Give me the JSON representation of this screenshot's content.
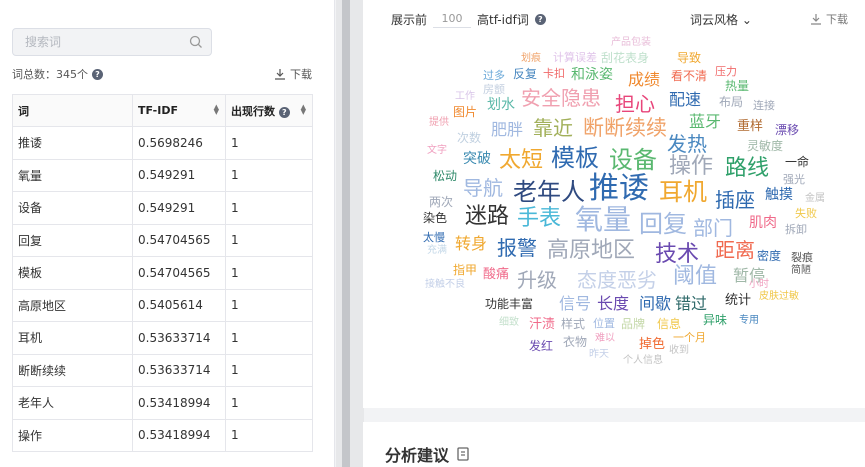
{
  "left": {
    "search_placeholder": "搜索词",
    "word_count_label": "词总数：345个",
    "download_label": "下载",
    "table": {
      "headers": [
        "词",
        "TF-IDF",
        "出现行数"
      ],
      "rows": [
        [
          "推诿",
          "0.5698246",
          "1"
        ],
        [
          "氧量",
          "0.549291",
          "1"
        ],
        [
          "设备",
          "0.549291",
          "1"
        ],
        [
          "回复",
          "0.54704565",
          "1"
        ],
        [
          "模板",
          "0.54704565",
          "1"
        ],
        [
          "高原地区",
          "0.5405614",
          "1"
        ],
        [
          "耳机",
          "0.53633714",
          "1"
        ],
        [
          "断断续续",
          "0.53633714",
          "1"
        ],
        [
          "老年人",
          "0.53418994",
          "1"
        ],
        [
          "操作",
          "0.53418994",
          "1"
        ]
      ]
    }
  },
  "right": {
    "show_prefix": "展示前",
    "show_count": "100",
    "show_suffix": "高tf-idf词",
    "style_label": "词云风格",
    "download_label": "下载",
    "words": [
      [
        "划痕",
        158,
        54,
        10,
        "#f0a36a"
      ],
      [
        "计算误差",
        190,
        52,
        11,
        "#e0c4ea"
      ],
      [
        "产品包装",
        248,
        38,
        10,
        "#e8bcd8"
      ],
      [
        "刮花表身",
        238,
        52,
        12,
        "#bfe0cc"
      ],
      [
        "导致",
        314,
        52,
        12,
        "#f0a830"
      ],
      [
        "过多",
        120,
        70,
        11,
        "#6aa8d8"
      ],
      [
        "反复",
        150,
        68,
        12,
        "#4a88c0"
      ],
      [
        "卡扣",
        180,
        68,
        11,
        "#f06a6a"
      ],
      [
        "和泳姿",
        208,
        68,
        14,
        "#5ab870"
      ],
      [
        "成绩",
        265,
        72,
        16,
        "#f08a30"
      ],
      [
        "看不清",
        308,
        70,
        12,
        "#f06a50"
      ],
      [
        "压力",
        352,
        66,
        11,
        "#f06a6a"
      ],
      [
        "房颤",
        120,
        84,
        11,
        "#c4d0e0"
      ],
      [
        "热量",
        362,
        80,
        12,
        "#5ab870"
      ],
      [
        "安全隐患",
        158,
        88,
        20,
        "#f0a0b0"
      ],
      [
        "担心",
        252,
        94,
        20,
        "#e8457a"
      ],
      [
        "配速",
        306,
        92,
        16,
        "#2f6ab0"
      ],
      [
        "工作",
        92,
        92,
        10,
        "#d8c4e8"
      ],
      [
        "划水",
        124,
        98,
        14,
        "#5ab8a8"
      ],
      [
        "布局",
        356,
        96,
        12,
        "#a0a8b8"
      ],
      [
        "连接",
        390,
        100,
        11,
        "#a0a8b8"
      ],
      [
        "图片",
        90,
        106,
        12,
        "#f08a30"
      ],
      [
        "提供",
        66,
        118,
        10,
        "#f0a0b0"
      ],
      [
        "肥胖",
        128,
        122,
        16,
        "#a0b8e0"
      ],
      [
        "靠近",
        170,
        118,
        20,
        "#a2b05a"
      ],
      [
        "断断续续",
        220,
        118,
        21,
        "#f0a36a"
      ],
      [
        "蓝牙",
        326,
        114,
        16,
        "#5ab870"
      ],
      [
        "重样",
        374,
        120,
        13,
        "#b06a30"
      ],
      [
        "漂移",
        412,
        124,
        12,
        "#6a4ab0"
      ],
      [
        "次数",
        94,
        132,
        12,
        "#c0d0e0"
      ],
      [
        "发热",
        304,
        134,
        20,
        "#4a88c0"
      ],
      [
        "灵敏度",
        384,
        140,
        12,
        "#a0b8a8"
      ],
      [
        "文字",
        64,
        146,
        10,
        "#f0a0c0"
      ],
      [
        "突破",
        100,
        152,
        14,
        "#3a8ab0"
      ],
      [
        "太短",
        136,
        150,
        22,
        "#f0a830"
      ],
      [
        "模板",
        188,
        146,
        24,
        "#2f6ab0"
      ],
      [
        "设备",
        246,
        148,
        24,
        "#5ab870"
      ],
      [
        "操作",
        306,
        156,
        22,
        "#a0a8b8"
      ],
      [
        "路线",
        362,
        158,
        22,
        "#2fa06a"
      ],
      [
        "一命",
        422,
        156,
        12,
        "#333"
      ],
      [
        "松动",
        70,
        170,
        12,
        "#2f8a6a"
      ],
      [
        "强光",
        420,
        174,
        11,
        "#a0a8b8"
      ],
      [
        "导航",
        100,
        178,
        20,
        "#a0b8e0"
      ],
      [
        "老年人",
        150,
        180,
        24,
        "#2f4a80"
      ],
      [
        "推诿",
        226,
        174,
        30,
        "#2f6ab0"
      ],
      [
        "耳机",
        296,
        180,
        24,
        "#f0a830"
      ],
      [
        "两次",
        66,
        196,
        12,
        "#a0a8b8"
      ],
      [
        "插座",
        352,
        190,
        20,
        "#2f6ab0"
      ],
      [
        "触摸",
        402,
        188,
        14,
        "#2f6ab0"
      ],
      [
        "金属",
        442,
        194,
        10,
        "#c4c4c4"
      ],
      [
        "迷路",
        102,
        206,
        22,
        "#333"
      ],
      [
        "手表",
        154,
        208,
        22,
        "#4ab8d8"
      ],
      [
        "氧量",
        212,
        206,
        28,
        "#a0b8e0"
      ],
      [
        "回复",
        276,
        212,
        24,
        "#a0b8e0"
      ],
      [
        "部门",
        330,
        218,
        20,
        "#a0b8e0"
      ],
      [
        "失败",
        432,
        208,
        11,
        "#f0c84a"
      ],
      [
        "染色",
        60,
        212,
        12,
        "#333"
      ],
      [
        "肌肉",
        386,
        216,
        14,
        "#f06a8a"
      ],
      [
        "太慢",
        60,
        232,
        11,
        "#2f6ab0"
      ],
      [
        "拆卸",
        422,
        224,
        11,
        "#a0a8b8"
      ],
      [
        "转身",
        92,
        236,
        16,
        "#f0a830"
      ],
      [
        "报警",
        134,
        238,
        20,
        "#2f6ab0"
      ],
      [
        "高原地区",
        184,
        240,
        22,
        "#a0a8b8"
      ],
      [
        "技术",
        292,
        244,
        22,
        "#6a4ab0"
      ],
      [
        "距离",
        352,
        240,
        20,
        "#f06a50"
      ],
      [
        "充满",
        64,
        246,
        10,
        "#c4d8e8"
      ],
      [
        "密度",
        394,
        250,
        12,
        "#2f6ab0"
      ],
      [
        "裂痕",
        428,
        252,
        11,
        "#555"
      ],
      [
        "指甲",
        90,
        264,
        12,
        "#f0a830"
      ],
      [
        "酸痛",
        120,
        268,
        13,
        "#f06a8a"
      ],
      [
        "升级",
        154,
        270,
        20,
        "#a0a8b8"
      ],
      [
        "态度恶劣",
        214,
        270,
        20,
        "#c4d0e8"
      ],
      [
        "阈值",
        310,
        266,
        22,
        "#a0b8e0"
      ],
      [
        "暂停",
        370,
        268,
        16,
        "#a0b8a8"
      ],
      [
        "简陋",
        428,
        266,
        10,
        "#555"
      ],
      [
        "接触不良",
        62,
        280,
        10,
        "#c4d0e8"
      ],
      [
        "小时",
        386,
        280,
        10,
        "#f0a0c0"
      ],
      [
        "皮肤过敏",
        396,
        292,
        10,
        "#f0c84a"
      ],
      [
        "功能丰富",
        122,
        298,
        12,
        "#333"
      ],
      [
        "信号",
        196,
        296,
        16,
        "#a0b8e0"
      ],
      [
        "长度",
        234,
        296,
        16,
        "#6a4ab0"
      ],
      [
        "间歇",
        276,
        296,
        16,
        "#2f6ab0"
      ],
      [
        "错过",
        312,
        296,
        16,
        "#2f6a6a"
      ],
      [
        "统计",
        362,
        294,
        13,
        "#333"
      ],
      [
        "细致",
        136,
        318,
        10,
        "#c4e0cc"
      ],
      [
        "汗渍",
        166,
        318,
        13,
        "#f06a8a"
      ],
      [
        "样式",
        198,
        318,
        12,
        "#a0a8b8"
      ],
      [
        "位置",
        230,
        318,
        11,
        "#a0b8e0"
      ],
      [
        "品牌",
        258,
        318,
        12,
        "#c4d8a8"
      ],
      [
        "信息",
        294,
        318,
        12,
        "#f0c84a"
      ],
      [
        "异味",
        340,
        314,
        12,
        "#2fa06a"
      ],
      [
        "专用",
        376,
        316,
        10,
        "#4a88c0"
      ],
      [
        "一个月",
        310,
        332,
        11,
        "#f0a830"
      ],
      [
        "发红",
        166,
        340,
        12,
        "#6a4ab0"
      ],
      [
        "衣物",
        200,
        336,
        12,
        "#a0a8b8"
      ],
      [
        "难以",
        232,
        334,
        10,
        "#f0a0c0"
      ],
      [
        "掉色",
        276,
        338,
        13,
        "#f06a30"
      ],
      [
        "昨天",
        226,
        350,
        10,
        "#c4d0e8"
      ],
      [
        "收到",
        306,
        346,
        10,
        "#c4c4c4"
      ],
      [
        "个人信息",
        260,
        356,
        10,
        "#c4c4c4"
      ]
    ]
  },
  "bottom": {
    "title": "分析建议"
  }
}
